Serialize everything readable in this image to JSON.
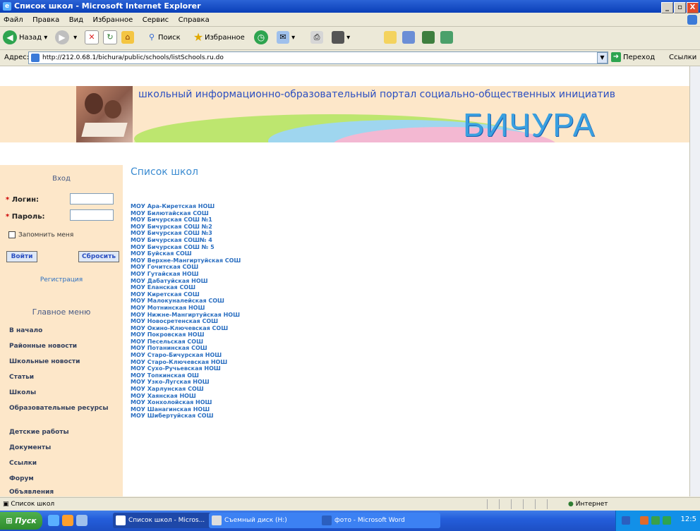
{
  "window": {
    "title": "Список школ - Microsoft Internet Explorer",
    "controls": [
      "_",
      "▫",
      "X"
    ]
  },
  "menu": [
    "Файл",
    "Правка",
    "Вид",
    "Избранное",
    "Сервис",
    "Справка"
  ],
  "toolbar": {
    "back": "Назад",
    "search": "Поиск",
    "favorites": "Избранное"
  },
  "address": {
    "label": "Адрес:",
    "url": "http://212.0.68.1/bichura/public/schools/listSchools.ru.do",
    "go": "Переход",
    "links": "Ссылки"
  },
  "banner": {
    "tagline": "школьный информационно-образовательный портал социально-общественных инициатив",
    "logo": "БИЧУРА"
  },
  "login": {
    "title": "Вход",
    "login_label": "Логин:",
    "password_label": "Пароль:",
    "remember": "Запомнить меня",
    "login_button": "Войти",
    "reset_button": "Сбросить",
    "register": "Регистрация"
  },
  "main_menu": {
    "title": "Главное меню",
    "items": [
      "В начало",
      "Районные новости",
      "Школьные новости",
      "Статьи",
      "Школы",
      "Образовательные ресурсы",
      "Детские работы",
      "Документы",
      "Ссылки",
      "Форум",
      "Объявления"
    ]
  },
  "page": {
    "title": "Список школ",
    "schools": [
      "МОУ Ара-Киретская НОШ",
      "МОУ Билютайская СОШ",
      "МОУ Бичурская СОШ №1",
      "МОУ Бичурская СОШ №2",
      "МОУ Бичурская СОШ №3",
      "МОУ Бичурская СОШ№ 4",
      "МОУ Бичурская СОШ № 5",
      "МОУ Буйская СОШ",
      "МОУ Верхне-Мангиртуйская СОШ",
      "МОУ Гочитская СОШ",
      "МОУ Гутайская НОШ",
      "МОУ Дабатуйская НОШ",
      "МОУ Еланская СОШ",
      "МОУ Киретская СОШ",
      "МОУ Малокуналейская СОШ",
      "МОУ Мотнинская НОШ",
      "МОУ Нижне-Мангиртуйская НОШ",
      "МОУ Новосретенская СОШ",
      "МОУ Окино-Ключевская СОШ",
      "МОУ Покровская НОШ",
      "МОУ Песельская СОШ",
      "МОУ Потанинская СОШ",
      "МОУ Старо-Бичурская НОШ",
      "МОУ Старо-Ключевская НОШ",
      "МОУ Сухо-Ручьевская НОШ",
      "МОУ Топкинская ОШ",
      "МОУ Узко-Лугская НОШ",
      "МОУ Харлунская СОШ",
      "МОУ Хаянская НОШ",
      "МОУ Хонхолойская НОШ",
      "МОУ Шанагинская НОШ",
      "МОУ Шибертуйская СОШ"
    ]
  },
  "status": {
    "text": "Список школ",
    "zone": "Интернет"
  },
  "taskbar": {
    "start": "Пуск",
    "tasks": [
      "Список школ - Micros...",
      "Съемный диск (H:)",
      "фото - Microsoft Word"
    ],
    "clock": "12:5"
  }
}
